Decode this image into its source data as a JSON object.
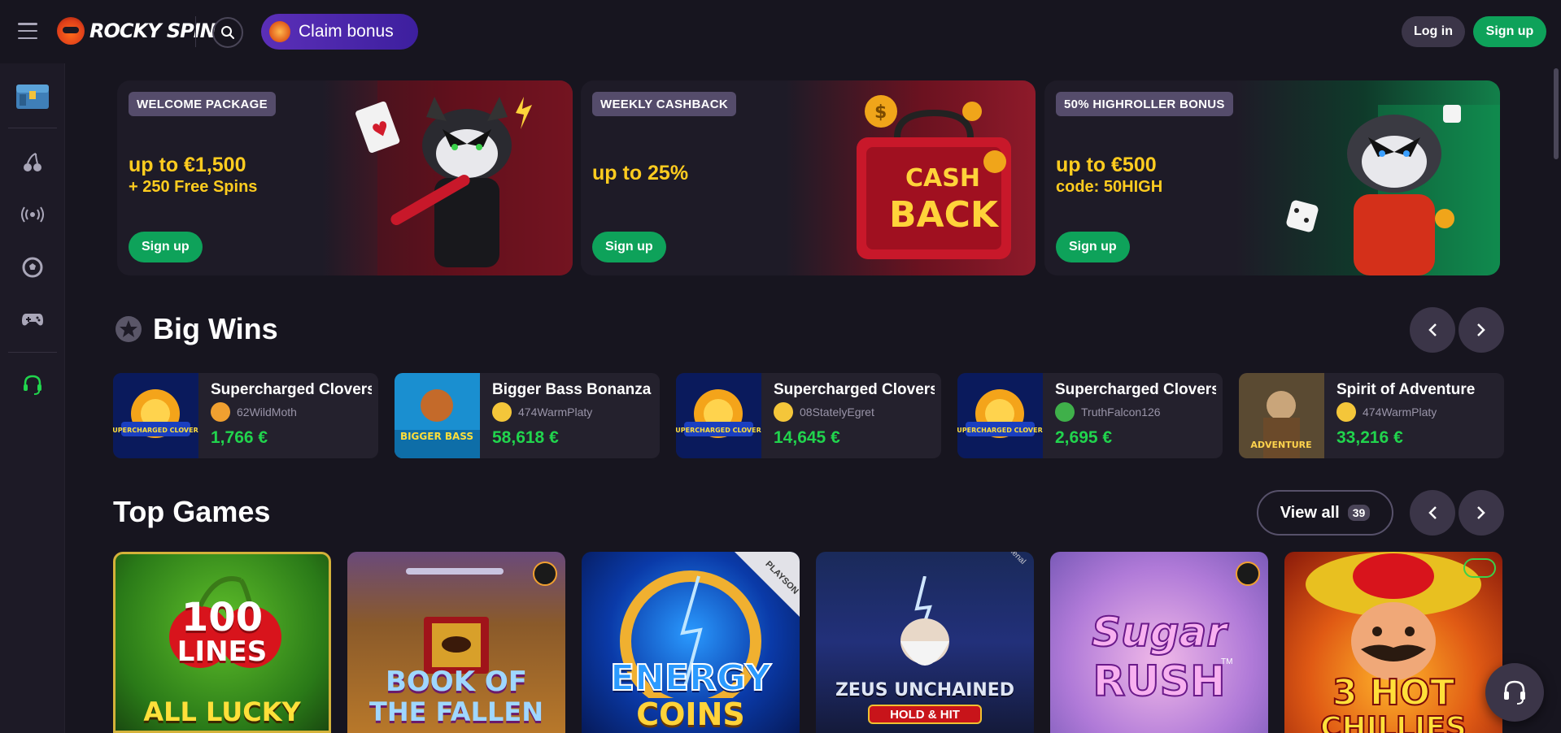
{
  "header": {
    "logo_text": "ROCKY SPIN",
    "claim_bonus_label": "Claim bonus",
    "login_label": "Log in",
    "signup_label": "Sign up"
  },
  "sidebar": {
    "items": [
      {
        "icon": "loot-box-icon"
      },
      {
        "icon": "cherry-icon"
      },
      {
        "icon": "live-broadcast-icon"
      },
      {
        "icon": "soccer-ball-icon"
      },
      {
        "icon": "gamepad-icon"
      },
      {
        "icon": "headset-icon"
      }
    ]
  },
  "banners": [
    {
      "tag": "WELCOME PACKAGE",
      "line1": "up to €1,500",
      "line2": "+ 250 Free Spins",
      "button": "Sign up"
    },
    {
      "tag": "WEEKLY CASHBACK",
      "line1": "up to 25%",
      "line2": "",
      "button": "Sign up",
      "art_text_1": "CASH",
      "art_text_2": "BACK"
    },
    {
      "tag": "50% HIGHROLLER BONUS",
      "line1": "up to €500",
      "line2": "code: 50HIGH",
      "button": "Sign up"
    }
  ],
  "big_wins": {
    "title": "Big Wins",
    "items": [
      {
        "game": "Supercharged Clovers",
        "user": "62WildMoth",
        "amount": "1,766 €",
        "thumb_text": "SUPERCHARGED CLOVERS"
      },
      {
        "game": "Bigger Bass Bonanza",
        "user": "474WarmPlaty",
        "amount": "58,618 €",
        "thumb_text": "BIGGER BASS"
      },
      {
        "game": "Supercharged Clovers",
        "user": "08StatelyEgret",
        "amount": "14,645 €",
        "thumb_text": "SUPERCHARGED CLOVERS"
      },
      {
        "game": "Supercharged Clovers",
        "user": "TruthFalcon126",
        "amount": "2,695 €",
        "thumb_text": "SUPERCHARGED CLOVERS"
      },
      {
        "game": "Spirit of Adventure",
        "user": "474WarmPlaty",
        "amount": "33,216 €",
        "thumb_text": "ADVENTURE"
      }
    ]
  },
  "top_games": {
    "title": "Top Games",
    "view_all_label": "View all",
    "view_all_count": "39",
    "tiles": [
      {
        "line1": "100",
        "line2": "LINES",
        "line3": "ALL LUCKY"
      },
      {
        "line1": "BOOK OF",
        "line2": "THE FALLEN",
        "line3": ""
      },
      {
        "line1": "ENERGY",
        "line2": "COINS",
        "line3": "",
        "badge": "PLAYSON"
      },
      {
        "line1": "ZEUS UNCHAINED",
        "line2": "HOLD & HIT",
        "line3": "",
        "badge": "Spinomenal"
      },
      {
        "line1": "Sugar",
        "line2": "RUSH",
        "line3": "",
        "tm": "TM"
      },
      {
        "line1": "3 HOT",
        "line2": "CHILLIES",
        "line3": ""
      }
    ]
  }
}
